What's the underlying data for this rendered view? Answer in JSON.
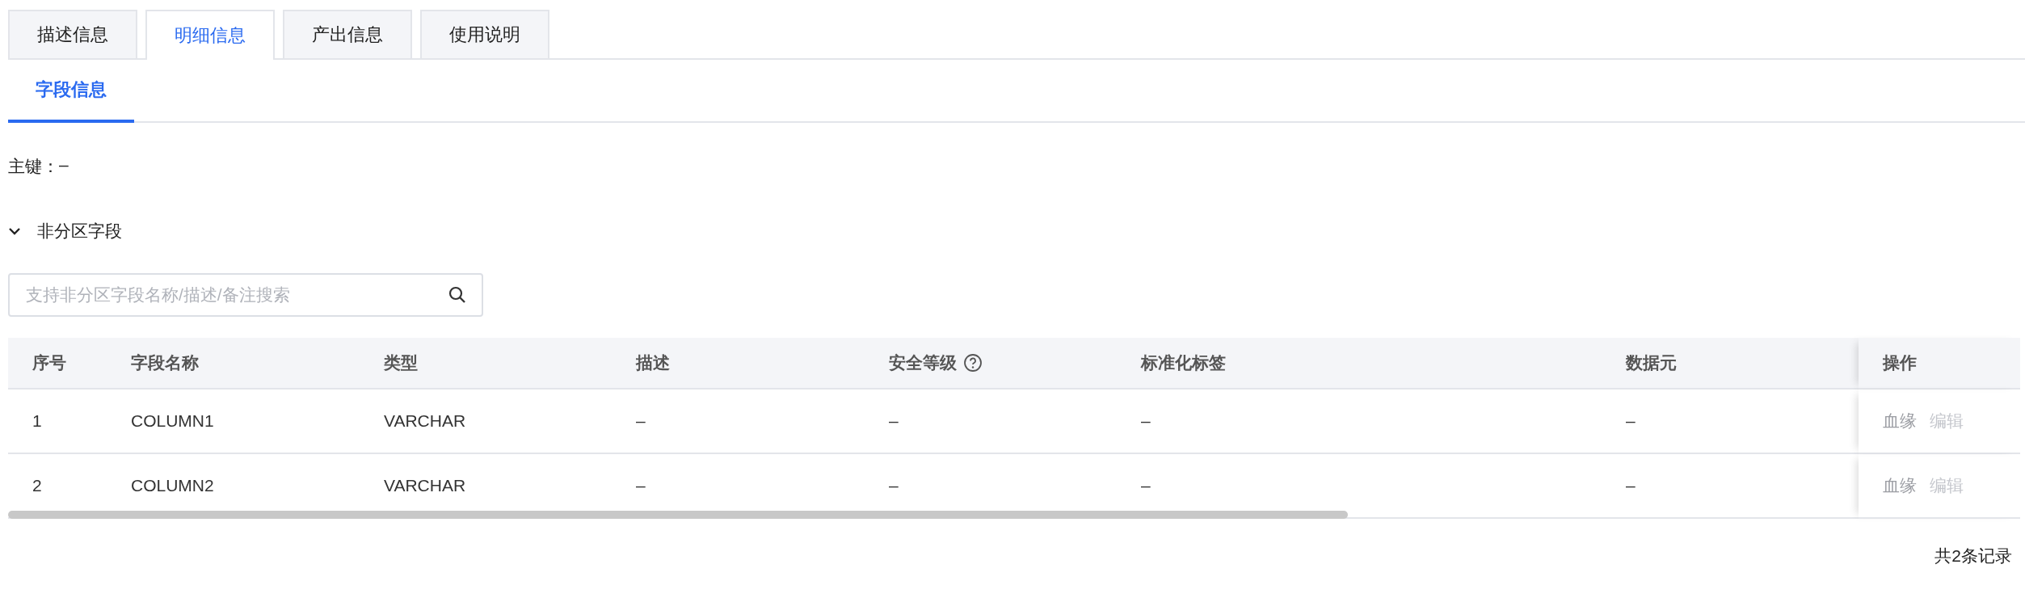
{
  "tabs": [
    {
      "label": "描述信息",
      "selected": false
    },
    {
      "label": "明细信息",
      "selected": true
    },
    {
      "label": "产出信息",
      "selected": false
    },
    {
      "label": "使用说明",
      "selected": false
    }
  ],
  "subtabs": [
    {
      "label": "字段信息",
      "selected": true
    }
  ],
  "primary_key": {
    "label": "主键：",
    "value": "–"
  },
  "section": {
    "title": "非分区字段",
    "expanded": true
  },
  "search": {
    "placeholder": "支持非分区字段名称/描述/备注搜索"
  },
  "table": {
    "columns": [
      {
        "label": "序号",
        "help": false
      },
      {
        "label": "字段名称",
        "help": false
      },
      {
        "label": "类型",
        "help": false
      },
      {
        "label": "描述",
        "help": false
      },
      {
        "label": "安全等级",
        "help": true
      },
      {
        "label": "标准化标签",
        "help": false
      },
      {
        "label": "数据元",
        "help": false
      },
      {
        "label": "操作",
        "help": false
      }
    ],
    "rows": [
      {
        "cells": [
          "1",
          "COLUMN1",
          "VARCHAR",
          "–",
          "–",
          "–",
          "–"
        ],
        "actions": [
          {
            "label": "血缘",
            "disabled": false
          },
          {
            "label": "编辑",
            "disabled": true
          }
        ]
      },
      {
        "cells": [
          "2",
          "COLUMN2",
          "VARCHAR",
          "–",
          "–",
          "–",
          "–"
        ],
        "actions": [
          {
            "label": "血缘",
            "disabled": false
          },
          {
            "label": "编辑",
            "disabled": true
          }
        ]
      }
    ]
  },
  "footer": {
    "total": "共2条记录"
  }
}
